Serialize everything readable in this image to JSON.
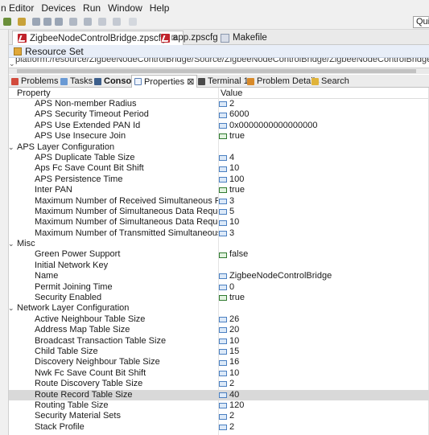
{
  "menu": [
    "n Editor",
    "Devices",
    "Run",
    "Window",
    "Help"
  ],
  "quick_access": "Qui",
  "editor_tabs": [
    {
      "label": "ZigbeeNodeControlBridge.zpscfg",
      "active": true,
      "closable": true
    },
    {
      "label": "app.zpscfg",
      "active": false,
      "closable": false
    },
    {
      "label": "Makefile",
      "active": false,
      "closable": false
    }
  ],
  "resource_set_label": "Resource Set",
  "resource_path": "platform:/resource/ZigbeeNodeControlBridge/Source/ZigbeeNodeControlBridge/ZigbeeNodeControlBridge.zpscfg",
  "view_tabs": [
    {
      "label": "Problems"
    },
    {
      "label": "Tasks"
    },
    {
      "label": "Console"
    },
    {
      "label": "Properties ⊠"
    },
    {
      "label": "Terminal 1"
    },
    {
      "label": "Problem Details"
    },
    {
      "label": "Search"
    }
  ],
  "columns": {
    "property": "Property",
    "value": "Value"
  },
  "rows": [
    {
      "type": "prop",
      "label": "APS Non-member Radius",
      "value": "2"
    },
    {
      "type": "prop",
      "label": "APS Security Timeout Period",
      "value": "6000"
    },
    {
      "type": "prop",
      "label": "APS Use Extended PAN Id",
      "value": "0x0000000000000000"
    },
    {
      "type": "prop",
      "label": "APS Use Insecure Join",
      "value": "true",
      "bool": true
    },
    {
      "type": "cat",
      "label": "APS Layer Configuration"
    },
    {
      "type": "prop",
      "label": "APS Duplicate Table Size",
      "value": "4"
    },
    {
      "type": "prop",
      "label": "Aps Fc Save Count Bit Shift",
      "value": "10"
    },
    {
      "type": "prop",
      "label": "APS Persistence Time",
      "value": "100"
    },
    {
      "type": "prop",
      "label": "Inter PAN",
      "value": "true",
      "bool": true
    },
    {
      "type": "prop",
      "label": "Maximum Number of Received Simultaneous Fragmer",
      "value": "3"
    },
    {
      "type": "prop",
      "label": "Maximum Number of Simultaneous Data Requests",
      "value": "5"
    },
    {
      "type": "prop",
      "label": "Maximum Number of Simultaneous Data Requests wit!",
      "value": "10"
    },
    {
      "type": "prop",
      "label": "Maximum Number of Transmitted Simultaneous Fragn",
      "value": "3"
    },
    {
      "type": "cat",
      "label": "Misc"
    },
    {
      "type": "prop",
      "label": "Green Power Support",
      "value": "false",
      "bool": true
    },
    {
      "type": "prop",
      "label": "Initial Network Key",
      "value": ""
    },
    {
      "type": "prop",
      "label": "Name",
      "value": "ZigbeeNodeControlBridge"
    },
    {
      "type": "prop",
      "label": "Permit Joining Time",
      "value": "0"
    },
    {
      "type": "prop",
      "label": "Security Enabled",
      "value": "true",
      "bool": true
    },
    {
      "type": "cat",
      "label": "Network Layer Configuration"
    },
    {
      "type": "prop",
      "label": "Active Neighbour Table Size",
      "value": "26"
    },
    {
      "type": "prop",
      "label": "Address Map Table Size",
      "value": "20"
    },
    {
      "type": "prop",
      "label": "Broadcast Transaction Table Size",
      "value": "10"
    },
    {
      "type": "prop",
      "label": "Child Table Size",
      "value": "15"
    },
    {
      "type": "prop",
      "label": "Discovery Neighbour Table Size",
      "value": "16"
    },
    {
      "type": "prop",
      "label": "Nwk Fc Save Count Bit Shift",
      "value": "10"
    },
    {
      "type": "prop",
      "label": "Route Discovery Table Size",
      "value": "2"
    },
    {
      "type": "prop",
      "label": "Route Record Table Size",
      "value": "40",
      "selected": true
    },
    {
      "type": "prop",
      "label": "Routing Table Size",
      "value": "120"
    },
    {
      "type": "prop",
      "label": "Security Material Sets",
      "value": "2"
    },
    {
      "type": "prop",
      "label": "Stack Profile",
      "value": "2"
    }
  ]
}
